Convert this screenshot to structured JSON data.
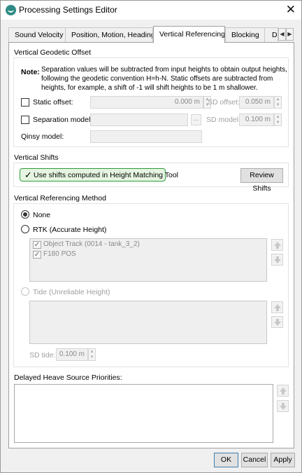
{
  "window": {
    "title": "Processing Settings Editor"
  },
  "tabs": [
    {
      "label": "Sound Velocity"
    },
    {
      "label": "Position, Motion, Heading"
    },
    {
      "label": "Vertical Referencing"
    },
    {
      "label": "Blocking"
    },
    {
      "label": "D"
    }
  ],
  "vertical_geodetic_offset": {
    "title": "Vertical Geodetic Offset",
    "note_label": "Note:",
    "note_text": "Separation values will be subtracted from input heights to obtain output heights, following the geodetic convention H=h-N. Static offsets are subtracted from heights, for example, a shift of -1 will shift heights to be 1 m shallower.",
    "static_offset_label": "Static offset:",
    "static_offset_value": "0.000 m",
    "sd_offset_label": "SD offset:",
    "sd_offset_value": "0.050 m",
    "separation_model_label": "Separation model:",
    "separation_model_value": "",
    "ellipsis": "...",
    "sd_model_label": "SD model:",
    "sd_model_value": "0.100 m",
    "qinsy_model_label": "Qinsy model:",
    "qinsy_model_value": ""
  },
  "vertical_shifts": {
    "title": "Vertical Shifts",
    "use_shifts_label": "Use shifts computed in Height Matching Tool",
    "use_shifts_checked": true,
    "review_shifts_label": "Review Shifts"
  },
  "vertical_referencing_method": {
    "title": "Vertical Referencing Method",
    "selected": "None",
    "none_label": "None",
    "rtk_label": "RTK (Accurate Height)",
    "rtk_items": [
      {
        "label": "Object Track (0014 - tank_3_2)",
        "checked": true
      },
      {
        "label": "F180 POS",
        "checked": true
      }
    ],
    "tide_label": "Tide (Unreliable Height)",
    "sd_tide_label": "SD tide:",
    "sd_tide_value": "0.100 m"
  },
  "delayed_heave": {
    "title": "Delayed Heave Source Priorities:"
  },
  "buttons": {
    "ok": "OK",
    "cancel": "Cancel",
    "apply": "Apply"
  },
  "icons": {
    "checkmark": "✓",
    "close": "✕",
    "spin_up": "▲",
    "spin_down": "▼",
    "tab_left": "◀",
    "tab_right": "▶"
  }
}
